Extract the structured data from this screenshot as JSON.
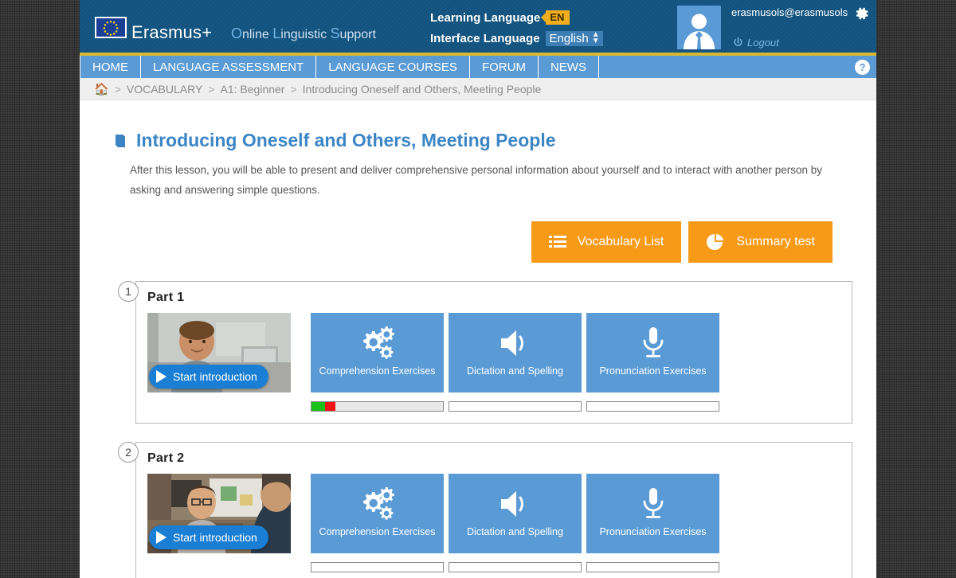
{
  "header": {
    "brand": "Erasmus+",
    "ols_parts": [
      {
        "cap": "O",
        "rest": "nline "
      },
      {
        "cap": "L",
        "rest": "inguistic "
      },
      {
        "cap": "S",
        "rest": "upport"
      }
    ],
    "learning_language_label": "Learning Language",
    "learning_language_value": "EN",
    "interface_language_label": "Interface Language",
    "interface_language_value": "English",
    "user_email": "erasmusols@erasmusols",
    "logout_label": "Logout",
    "gear_icon": "gear-icon",
    "power_icon": "power-icon",
    "avatar_icon": "user-avatar-icon",
    "flag_icon": "eu-flag-icon",
    "colors": {
      "header_bg": "#12537f",
      "gold_rule": "#d6b832",
      "nav_bg": "#5a9bd5",
      "badge": "#f0ad1e"
    }
  },
  "nav": {
    "items": [
      {
        "label": "HOME",
        "name": "nav-item-home"
      },
      {
        "label": "LANGUAGE ASSESSMENT",
        "name": "nav-item-language-assessment"
      },
      {
        "label": "LANGUAGE COURSES",
        "name": "nav-item-language-courses"
      },
      {
        "label": "FORUM",
        "name": "nav-item-forum"
      },
      {
        "label": "NEWS",
        "name": "nav-item-news"
      }
    ],
    "help_label": "?"
  },
  "breadcrumb": {
    "home_icon": "home-icon",
    "sep": ">",
    "items": [
      "VOCABULARY",
      "A1: Beginner",
      "Introducing Oneself and Others, Meeting People"
    ]
  },
  "lesson": {
    "book_icon": "book-icon",
    "title": "Introducing Oneself and Others, Meeting People",
    "description": "After this lesson, you will be able to present and deliver comprehensive personal information about yourself and to interact with another person by asking and answering simple questions.",
    "actions": [
      {
        "label": "Vocabulary List",
        "icon": "list-icon",
        "name": "vocabulary-list-button"
      },
      {
        "label": "Summary test",
        "icon": "pie-chart-icon",
        "name": "summary-test-button"
      }
    ]
  },
  "parts": [
    {
      "number": "1",
      "title": "Part 1",
      "video": {
        "play_label": "Start introduction",
        "alt": "young-man-in-classroom-thumbnail"
      },
      "tiles": [
        {
          "label": "Comprehension Exercises",
          "icon": "gears-icon",
          "name": "comprehension-exercises-tile",
          "progress": {
            "green_pct": 10,
            "red_pct": 8,
            "filled": true
          }
        },
        {
          "label": "Dictation and Spelling",
          "icon": "speaker-icon",
          "name": "dictation-and-spelling-tile",
          "progress": {
            "green_pct": 0,
            "red_pct": 0,
            "filled": false
          }
        },
        {
          "label": "Pronunciation Exercises",
          "icon": "microphone-icon",
          "name": "pronunciation-exercises-tile",
          "progress": {
            "green_pct": 0,
            "red_pct": 0,
            "filled": false
          }
        }
      ]
    },
    {
      "number": "2",
      "title": "Part 2",
      "video": {
        "play_label": "Start introduction",
        "alt": "two-men-talking-in-room-thumbnail"
      },
      "tiles": [
        {
          "label": "Comprehension Exercises",
          "icon": "gears-icon",
          "name": "comprehension-exercises-tile",
          "progress": {
            "green_pct": 0,
            "red_pct": 0,
            "filled": false
          }
        },
        {
          "label": "Dictation and Spelling",
          "icon": "speaker-icon",
          "name": "dictation-and-spelling-tile",
          "progress": {
            "green_pct": 0,
            "red_pct": 0,
            "filled": false
          }
        },
        {
          "label": "Pronunciation Exercises",
          "icon": "microphone-icon",
          "name": "pronunciation-exercises-tile",
          "progress": {
            "green_pct": 0,
            "red_pct": 0,
            "filled": false
          }
        }
      ]
    }
  ]
}
